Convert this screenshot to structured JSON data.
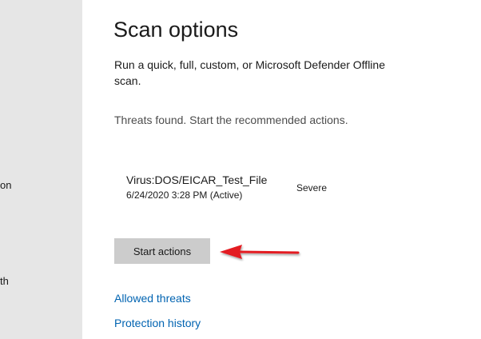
{
  "sidebar": {
    "label_one": "on",
    "label_two": "th"
  },
  "page": {
    "title": "Scan options",
    "description": "Run a quick, full, custom, or Microsoft Defender Offline scan.",
    "status": "Threats found. Start the recommended actions."
  },
  "threat": {
    "name": "Virus:DOS/EICAR_Test_File",
    "date": "6/24/2020 3:28 PM (Active)",
    "severity": "Severe"
  },
  "actions": {
    "start_label": "Start actions"
  },
  "links": {
    "allowed_threats": "Allowed threats",
    "protection_history": "Protection history"
  },
  "annotation": {
    "arrow_color": "#e31e24",
    "arrow_icon": "red-arrow-left-icon"
  },
  "colors": {
    "sidebar_bg": "#e6e6e6",
    "button_bg": "#cccccc",
    "link": "#0063b1"
  }
}
